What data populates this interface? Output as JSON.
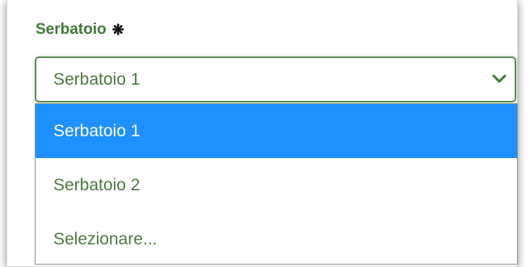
{
  "field": {
    "label": "Serbatoio",
    "required_mark": "❋",
    "selected_value": "Serbatoio 1"
  },
  "dropdown": {
    "options": [
      {
        "label": "Serbatoio 1",
        "selected": true
      },
      {
        "label": "Serbatoio 2",
        "selected": false
      },
      {
        "label": "Selezionare...",
        "selected": false
      }
    ]
  },
  "colors": {
    "label_green": "#3f7a35",
    "text_green": "#4c7a3f",
    "border_green": "#5e8e55",
    "highlight_blue": "#1e90ff"
  },
  "icons": {
    "dropdown_arrow": "chevron-down-icon",
    "required": "asterisk-icon"
  }
}
